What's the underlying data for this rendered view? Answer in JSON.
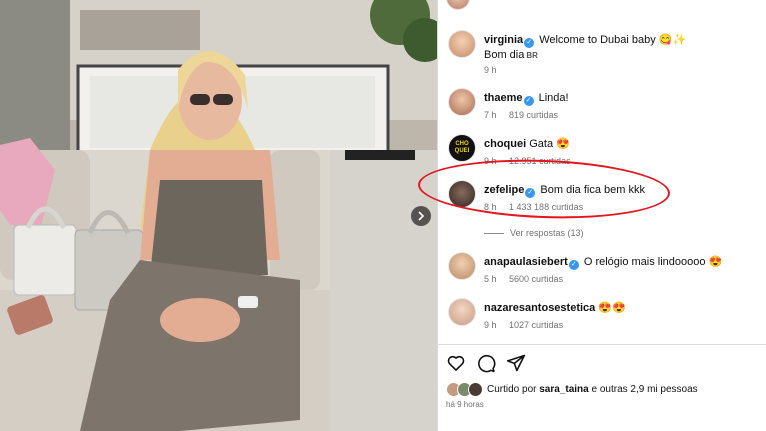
{
  "comments": [
    {
      "username": "virginia",
      "verified": true,
      "text": "Welcome to Dubai baby 😋✨",
      "line2": "Bom dia",
      "flag": "BR",
      "time": "9 h",
      "likes": ""
    },
    {
      "username": "thaeme",
      "verified": true,
      "text": "Linda!",
      "time": "7 h",
      "likes": "819 curtidas"
    },
    {
      "username": "choquei",
      "verified": false,
      "text": "Gata 😍",
      "time": "9 h",
      "likes": "12.951 curtidas",
      "avatar_text": "CHO QUEI"
    },
    {
      "username": "zefelipe",
      "verified": true,
      "text": "Bom dia fica bem kkk",
      "time": "8 h",
      "likes": "1 433 188 curtidas"
    },
    {
      "username": "anapaulasiebert",
      "verified": true,
      "text": "O relógio mais lindooooo 😍",
      "time": "5 h",
      "likes": "5600 curtidas"
    },
    {
      "username": "nazaresantosestetica",
      "verified": false,
      "text": "😍😍",
      "time": "9 h",
      "likes": "1027 curtidas"
    }
  ],
  "view_replies": "Ver respostas (13)",
  "liked_by": {
    "prefix": "Curtido por",
    "user": "sara_taina",
    "suffix": "e outras 2,9 mi pessoas"
  },
  "post_time": "há 9 horas",
  "icons": [
    "heart-icon",
    "comment-icon",
    "share-icon",
    "chevron-right-icon",
    "verified-badge-icon"
  ],
  "colors": {
    "verified": "#3897f0",
    "highlight": "#e4161d",
    "meta": "#737373"
  }
}
